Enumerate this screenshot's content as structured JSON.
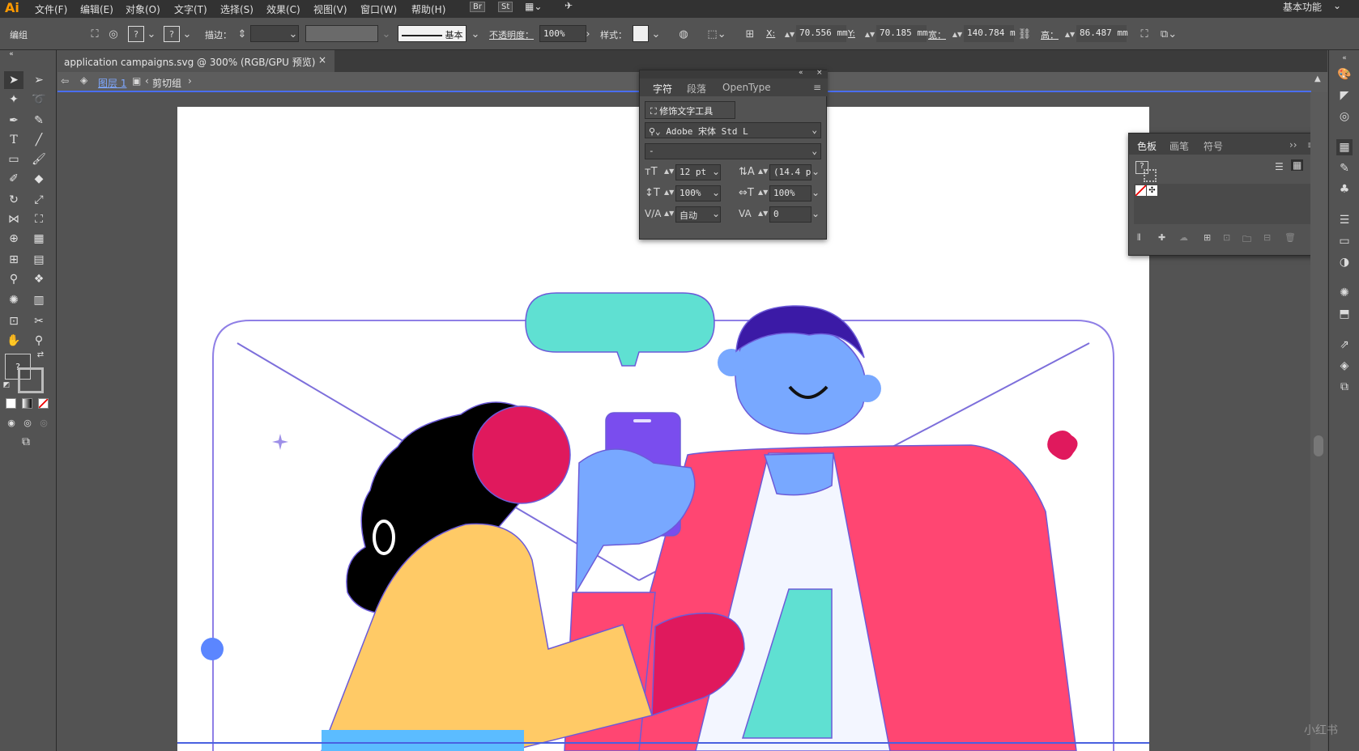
{
  "app": {
    "logo": "Ai",
    "workspace": "基本功能"
  },
  "menu": [
    "文件(F)",
    "编辑(E)",
    "对象(O)",
    "文字(T)",
    "选择(S)",
    "效果(C)",
    "视图(V)",
    "窗口(W)",
    "帮助(H)"
  ],
  "menu_badges": [
    "Br",
    "St"
  ],
  "control": {
    "selection": "编组",
    "stroke_label": "描边：",
    "stroke_style": "基本",
    "opacity_label": "不透明度：",
    "opacity_value": "100%",
    "style_label": "样式：",
    "x_label": "X:",
    "x_value": "70.556 mm",
    "y_label": "Y:",
    "y_value": "70.185 mm",
    "w_label": "宽：",
    "w_value": "140.784 m",
    "h_label": "高：",
    "h_value": "86.487 mm"
  },
  "document": {
    "tab_title": "application campaigns.svg @ 300% (RGB/GPU 预览)",
    "close": "×",
    "layer": "图层 1",
    "group": "剪切组"
  },
  "char_panel": {
    "tabs": [
      "字符",
      "段落",
      "OpenType"
    ],
    "touch_tool": "修饰文字工具",
    "font": "Adobe 宋体 Std L",
    "style": "-",
    "size": "12 pt",
    "leading": "(14.4 p",
    "vscale": "100%",
    "hscale": "100%",
    "kerning": "自动",
    "tracking": "0"
  },
  "swatch_panel": {
    "tabs": [
      "色板",
      "画笔",
      "符号"
    ],
    "help": "?"
  },
  "colors": {
    "yellow": "#ffca66",
    "red": "#ff4672",
    "crimson": "#e0195d",
    "blue": "#78a8ff",
    "purple": "#7a4dee",
    "teal": "#5fe0d2",
    "navy": "#3b1aa6",
    "outline": "#6c5bd8",
    "anchor": "#4a61e0"
  },
  "watermark": "小红书"
}
